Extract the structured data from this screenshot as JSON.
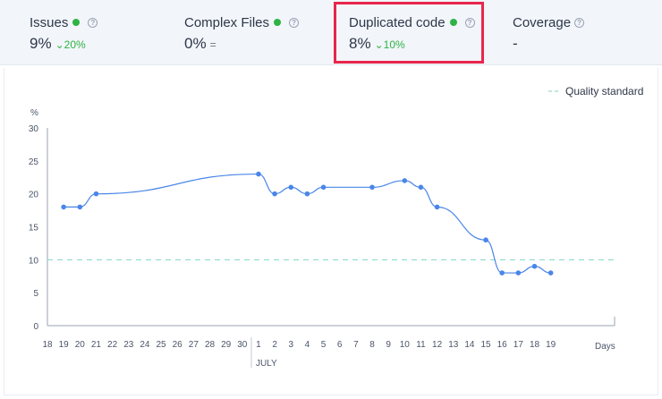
{
  "metrics": [
    {
      "title": "Issues",
      "value": "9%",
      "delta": "20%",
      "delta_dir": "down",
      "status_color": "#2fb344"
    },
    {
      "title": "Complex Files",
      "value": "0%",
      "delta": "=",
      "delta_dir": "flat",
      "status_color": "#2fb344"
    },
    {
      "title": "Duplicated code",
      "value": "8%",
      "delta": "10%",
      "delta_dir": "down",
      "status_color": "#2fb344"
    },
    {
      "title": "Coverage",
      "value": "-",
      "delta": "",
      "delta_dir": "none",
      "status_color": ""
    }
  ],
  "colors": {
    "line": "#4a86e8",
    "standard": "#7fd6c2",
    "highlight": "#e8264b",
    "positive": "#2fb344"
  },
  "chart_data": {
    "type": "line",
    "ylabel": "%",
    "xlabel": "Days",
    "ylim": [
      0,
      30
    ],
    "yticks": [
      0,
      5,
      10,
      15,
      20,
      25,
      30
    ],
    "x_ticks": [
      "18",
      "19",
      "20",
      "21",
      "22",
      "23",
      "24",
      "25",
      "26",
      "27",
      "28",
      "29",
      "30",
      "1",
      "2",
      "3",
      "4",
      "5",
      "6",
      "7",
      "8",
      "9",
      "10",
      "11",
      "12",
      "13",
      "14",
      "15",
      "16",
      "17",
      "18",
      "19"
    ],
    "month_label": "JULY",
    "month_starts_at": "1",
    "legend": {
      "label": "Quality standard",
      "placement": "top-right"
    },
    "quality_standard": 10,
    "series": [
      {
        "x": [
          "19",
          "20",
          "21",
          "1",
          "2",
          "3",
          "4",
          "5",
          "8",
          "10",
          "11",
          "12",
          "15",
          "16",
          "17",
          "18",
          "19"
        ],
        "x_index": [
          1,
          2,
          3,
          13,
          14,
          15,
          16,
          17,
          20,
          22,
          23,
          24,
          27,
          28,
          29,
          30,
          31
        ],
        "values": [
          18,
          18,
          20,
          23,
          20,
          21,
          20,
          21,
          21,
          22,
          21,
          18,
          13,
          8,
          8,
          9,
          8
        ]
      }
    ]
  }
}
